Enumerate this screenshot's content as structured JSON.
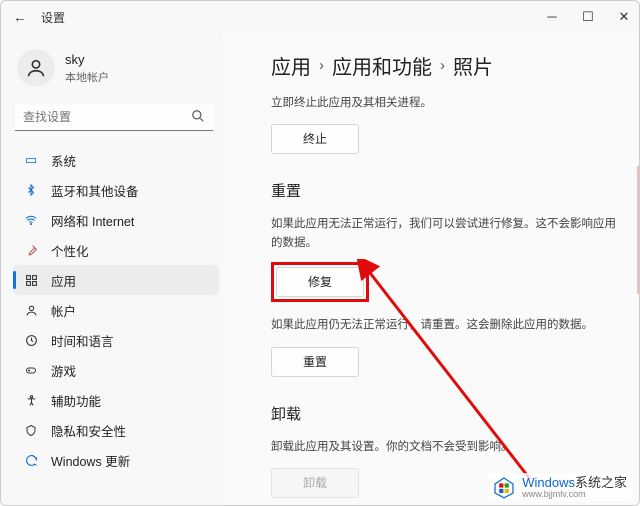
{
  "titlebar": {
    "back_icon": "←",
    "title": "设置"
  },
  "user": {
    "name": "sky",
    "sub": "本地帐户"
  },
  "search": {
    "placeholder": "查找设置"
  },
  "sidebar": {
    "items": [
      {
        "label": "系统"
      },
      {
        "label": "蓝牙和其他设备"
      },
      {
        "label": "网络和 Internet"
      },
      {
        "label": "个性化"
      },
      {
        "label": "应用"
      },
      {
        "label": "帐户"
      },
      {
        "label": "时间和语言"
      },
      {
        "label": "游戏"
      },
      {
        "label": "辅助功能"
      },
      {
        "label": "隐私和安全性"
      },
      {
        "label": "Windows 更新"
      }
    ]
  },
  "breadcrumb": {
    "a": "应用",
    "b": "应用和功能",
    "c": "照片"
  },
  "terminate": {
    "desc": "立即终止此应用及其相关进程。",
    "btn": "终止"
  },
  "reset": {
    "title": "重置",
    "desc1": "如果此应用无法正常运行，我们可以尝试进行修复。这不会影响应用的数据。",
    "repair_btn": "修复",
    "desc2": "如果此应用仍无法正常运行，请重置。这会删除此应用的数据。",
    "reset_btn": "重置"
  },
  "uninstall": {
    "title": "卸载",
    "desc": "卸载此应用及其设置。你的文档不会受到影响。",
    "btn": "卸载"
  },
  "watermark": {
    "brand": "Windows",
    "suffix": "系统之家",
    "url": "www.bjjmlv.com"
  }
}
